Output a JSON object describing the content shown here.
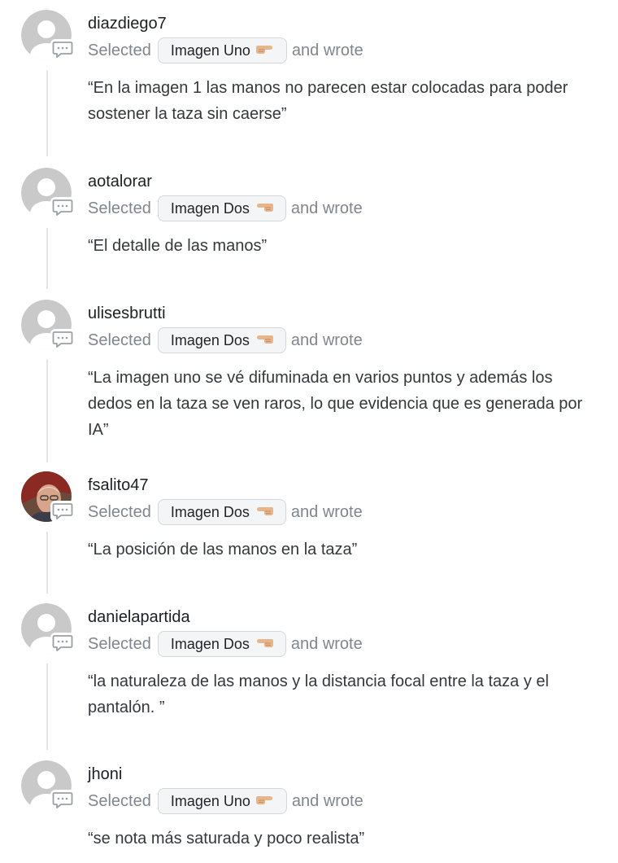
{
  "selected_label": "Selected",
  "wrote_label": "and wrote",
  "colors": {
    "placeholder_avatar": "#c9c9c9",
    "thread_line": "#e3e5e8",
    "pill_background": "#f4f5f7",
    "muted_text": "#80868e",
    "hand_emoji": "#e8b58a"
  },
  "entries": [
    {
      "username": "diazdiego7",
      "choice": "Imagen Uno",
      "hand_icon": "hand-pointing-right-icon",
      "comment": "“En la imagen 1 las manos no parecen estar colocadas para poder sostener la taza sin caerse”",
      "avatar": "placeholder"
    },
    {
      "username": "aotalorar",
      "choice": "Imagen Dos",
      "hand_icon": "hand-pointing-left-icon",
      "comment": "“El detalle de las manos”",
      "avatar": "placeholder"
    },
    {
      "username": "ulisesbrutti",
      "choice": "Imagen Dos",
      "hand_icon": "hand-pointing-left-icon",
      "comment": "“La imagen uno se vé difuminada en varios puntos y además los dedos en la taza se ven raros, lo que evidencia que es generada por IA”",
      "avatar": "placeholder"
    },
    {
      "username": "fsalito47",
      "choice": "Imagen Dos",
      "hand_icon": "hand-pointing-left-icon",
      "comment": "“La posición de las manos en la taza”",
      "avatar": "photo"
    },
    {
      "username": "danielapartida",
      "choice": "Imagen Dos",
      "hand_icon": "hand-pointing-left-icon",
      "comment": "“la naturaleza de las manos y la distancia focal entre la taza y el pantalón. ”",
      "avatar": "placeholder"
    },
    {
      "username": "jhoni",
      "choice": "Imagen Uno",
      "hand_icon": "hand-pointing-right-icon",
      "comment": "“se nota más saturada y poco realista”",
      "avatar": "placeholder"
    }
  ]
}
